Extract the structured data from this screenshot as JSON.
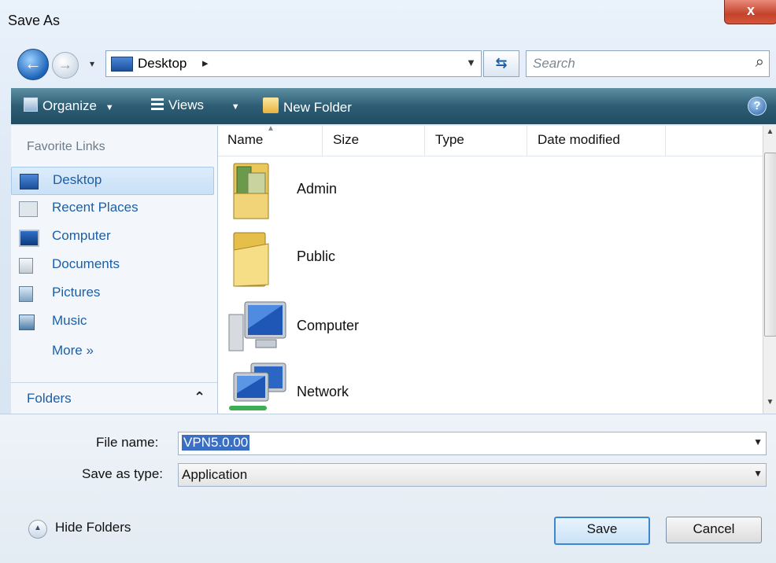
{
  "window": {
    "title": "Save As",
    "close_glyph": "x"
  },
  "nav": {
    "back_icon": "back-arrow-icon",
    "forward_icon": "forward-arrow-icon",
    "address_location": "Desktop",
    "search_placeholder": "Search"
  },
  "toolbar": {
    "organize_label": "Organize",
    "views_label": "Views",
    "new_folder_label": "New Folder",
    "help_glyph": "?"
  },
  "sidebar": {
    "heading": "Favorite Links",
    "items": [
      {
        "label": "Desktop",
        "icon": "desktop-icon"
      },
      {
        "label": "Recent Places",
        "icon": "recent-places-icon"
      },
      {
        "label": "Computer",
        "icon": "computer-icon"
      },
      {
        "label": "Documents",
        "icon": "documents-icon"
      },
      {
        "label": "Pictures",
        "icon": "pictures-icon"
      },
      {
        "label": "Music",
        "icon": "music-icon"
      }
    ],
    "selected_index": 0,
    "more_label": "More »",
    "folders_label": "Folders"
  },
  "file_list": {
    "columns": [
      "Name",
      "Size",
      "Type",
      "Date modified"
    ],
    "items": [
      {
        "name": "Admin",
        "icon": "user-folder-icon"
      },
      {
        "name": "Public",
        "icon": "folder-icon"
      },
      {
        "name": "Computer",
        "icon": "computer-icon"
      },
      {
        "name": "Network",
        "icon": "network-icon"
      }
    ]
  },
  "form": {
    "file_name_label": "File name:",
    "file_name_value": "VPN5.0.00",
    "save_type_label": "Save as type:",
    "save_type_value": "Application"
  },
  "footer": {
    "hide_folders_label": "Hide Folders",
    "save_label": "Save",
    "cancel_label": "Cancel"
  },
  "colors": {
    "toolbar_top": "#5d8fa3",
    "toolbar_bottom": "#1f4d63",
    "link_blue": "#1b5fa8",
    "selection_blue": "#3a6fc4"
  }
}
